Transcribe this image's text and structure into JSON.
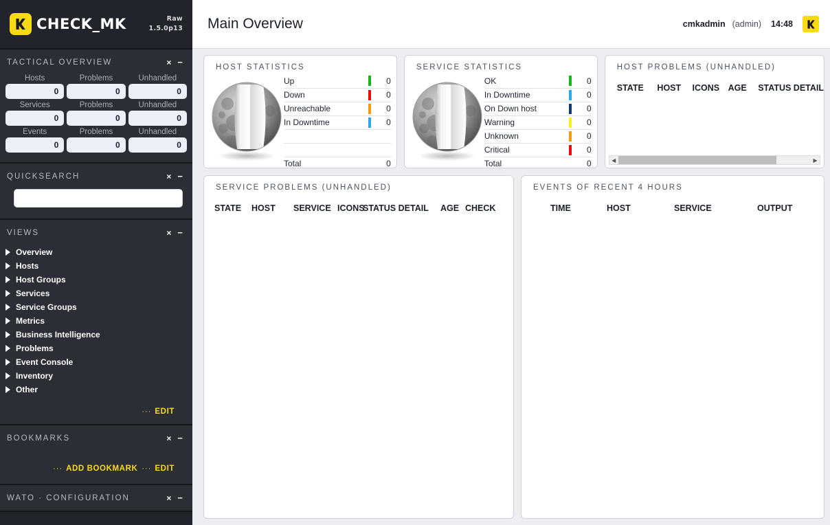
{
  "sidebar": {
    "logo": {
      "text": "CHECK_MK",
      "edition": "Raw",
      "version": "1.5.0p13",
      "icon": "checkmk-logo-icon"
    },
    "tactical": {
      "title": "Tactical Overview",
      "rows": [
        {
          "cells": [
            {
              "label": "Hosts",
              "value": "0"
            },
            {
              "label": "Problems",
              "value": "0"
            },
            {
              "label": "Unhandled",
              "value": "0"
            }
          ]
        },
        {
          "cells": [
            {
              "label": "Services",
              "value": "0"
            },
            {
              "label": "Problems",
              "value": "0"
            },
            {
              "label": "Unhandled",
              "value": "0"
            }
          ]
        },
        {
          "cells": [
            {
              "label": "Events",
              "value": "0"
            },
            {
              "label": "Problems",
              "value": "0"
            },
            {
              "label": "Unhandled",
              "value": "0"
            }
          ]
        }
      ]
    },
    "quicksearch": {
      "title": "Quicksearch",
      "value": "",
      "placeholder": ""
    },
    "views": {
      "title": "Views",
      "items": [
        {
          "label": "Overview"
        },
        {
          "label": "Hosts"
        },
        {
          "label": "Host Groups"
        },
        {
          "label": "Services"
        },
        {
          "label": "Service Groups"
        },
        {
          "label": "Metrics"
        },
        {
          "label": "Business Intelligence"
        },
        {
          "label": "Problems"
        },
        {
          "label": "Event Console"
        },
        {
          "label": "Inventory"
        },
        {
          "label": "Other"
        }
      ],
      "edit_label": "Edit",
      "dots": "···"
    },
    "bookmarks": {
      "title": "Bookmarks",
      "add_label": "Add Bookmark",
      "edit_label": "Edit",
      "dots": "···"
    },
    "wato": {
      "title": "WATO · Configuration"
    },
    "close_icon": "×",
    "minimize_icon": "−"
  },
  "header": {
    "title": "Main Overview",
    "user": "cmkadmin",
    "role": "(admin)",
    "time": "14:48",
    "logo_icon": "checkmk-logo-icon"
  },
  "panels": {
    "host_statistics": {
      "title": "Host Statistics",
      "rows": [
        {
          "label": "Up",
          "value": "0",
          "color": "#13b71b"
        },
        {
          "label": "Down",
          "value": "0",
          "color": "#e70d0d"
        },
        {
          "label": "Unreachable",
          "value": "0",
          "color": "#f59a0d"
        },
        {
          "label": "In Downtime",
          "value": "0",
          "color": "#27a8ef"
        }
      ],
      "empty_rows": 2,
      "total_label": "Total",
      "total_value": "0"
    },
    "service_statistics": {
      "title": "Service Statistics",
      "rows": [
        {
          "label": "OK",
          "value": "0",
          "color": "#13b71b"
        },
        {
          "label": "In Downtime",
          "value": "0",
          "color": "#27a8ef"
        },
        {
          "label": "On Down host",
          "value": "0",
          "color": "#103a6e"
        },
        {
          "label": "Warning",
          "value": "0",
          "color": "#f5f121"
        },
        {
          "label": "Unknown",
          "value": "0",
          "color": "#f59a0d"
        },
        {
          "label": "Critical",
          "value": "0",
          "color": "#e70d0d"
        }
      ],
      "empty_rows": 0,
      "total_label": "Total",
      "total_value": "0"
    },
    "host_problems": {
      "title": "Host Problems (unhandled)",
      "columns": [
        "STATE",
        "HOST",
        "ICONS",
        "AGE",
        "STATUS DETAIL"
      ],
      "rows": [],
      "scrollbar": {
        "left_arrow": "◀",
        "right_arrow": "▶"
      }
    },
    "service_problems": {
      "title": "Service Problems (unhandled)",
      "columns": [
        "STATE",
        "HOST",
        "SERVICE",
        "ICONS",
        "STATUS DETAIL",
        "AGE",
        "CHECK"
      ],
      "rows": []
    },
    "events": {
      "title": "Events of recent 4 hours",
      "columns": [
        "TIME",
        "HOST",
        "SERVICE",
        "OUTPUT"
      ],
      "rows": []
    }
  }
}
